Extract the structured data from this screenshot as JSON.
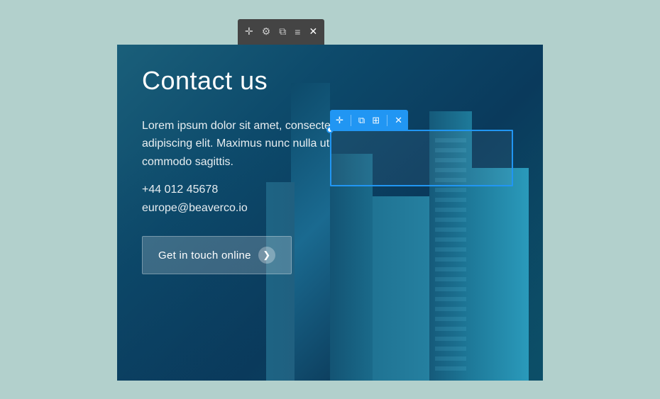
{
  "editor": {
    "top_toolbar": {
      "move_icon": "✛",
      "wrench_icon": "🔧",
      "copy_icon": "⧉",
      "menu_icon": "≡",
      "close_icon": "✕"
    },
    "widget_toolbar": {
      "move_icon": "✛",
      "copy_icon": "⧉",
      "columns_icon": "⊞",
      "close_icon": "✕"
    }
  },
  "content": {
    "title": "Contact us",
    "body": "Lorem ipsum dolor sit amet, consectetur adipiscing elit. Maximus nunc nulla ut commodo sagittis.",
    "phone": "+44 012 45678",
    "email": "europe@beaverco.io",
    "cta_button": "Get in touch online",
    "cta_arrow": "❯"
  },
  "colors": {
    "bg_teal": "#b2d0cc",
    "panel_blue_dark": "#0d4a6b",
    "toolbar_blue": "#2196f3",
    "toolbar_dark": "#444444"
  }
}
